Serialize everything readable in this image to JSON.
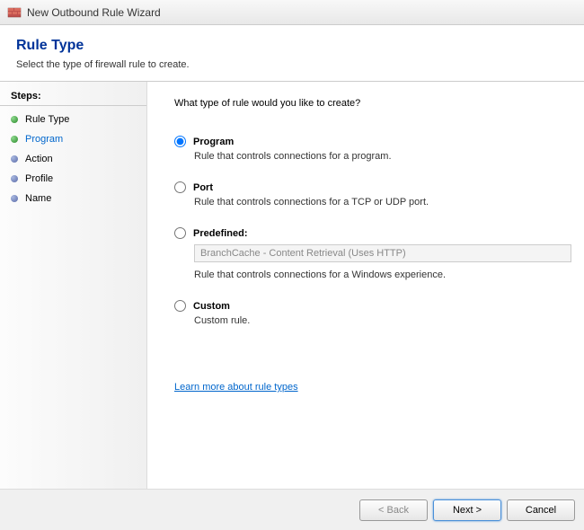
{
  "window": {
    "title": "New Outbound Rule Wizard"
  },
  "header": {
    "title": "Rule Type",
    "subtitle": "Select the type of firewall rule to create."
  },
  "steps": {
    "header": "Steps:",
    "items": [
      {
        "label": "Rule Type",
        "bullet": "green",
        "current": false
      },
      {
        "label": "Program",
        "bullet": "green",
        "current": true
      },
      {
        "label": "Action",
        "bullet": "blue",
        "current": false
      },
      {
        "label": "Profile",
        "bullet": "blue",
        "current": false
      },
      {
        "label": "Name",
        "bullet": "blue",
        "current": false
      }
    ]
  },
  "content": {
    "question": "What type of rule would you like to create?",
    "options": {
      "program": {
        "title": "Program",
        "desc": "Rule that controls connections for a program.",
        "checked": true
      },
      "port": {
        "title": "Port",
        "desc": "Rule that controls connections for a TCP or UDP port.",
        "checked": false
      },
      "predefined": {
        "title": "Predefined:",
        "select_value": "BranchCache - Content Retrieval (Uses HTTP)",
        "desc": "Rule that controls connections for a Windows experience.",
        "checked": false
      },
      "custom": {
        "title": "Custom",
        "desc": "Custom rule.",
        "checked": false
      }
    },
    "learn_more": "Learn more about rule types"
  },
  "footer": {
    "back": "< Back",
    "next": "Next >",
    "cancel": "Cancel"
  }
}
